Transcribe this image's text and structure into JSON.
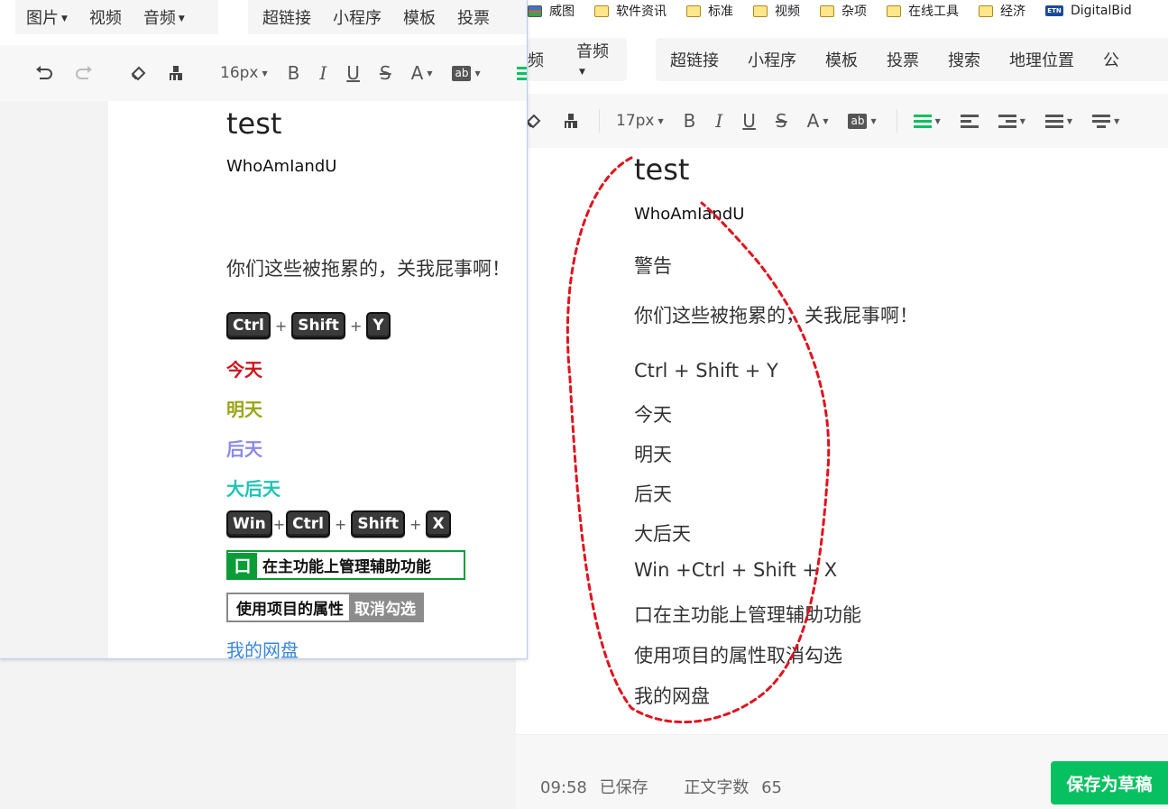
{
  "bookmarks": [
    {
      "icon": "image-icon",
      "label": "威图"
    },
    {
      "icon": "folder-icon",
      "label": "软件资讯"
    },
    {
      "icon": "folder-icon",
      "label": "标准"
    },
    {
      "icon": "folder-icon",
      "label": "视频"
    },
    {
      "icon": "folder-icon",
      "label": "杂项"
    },
    {
      "icon": "folder-icon",
      "label": "在线工具"
    },
    {
      "icon": "folder-icon",
      "label": "经济"
    },
    {
      "icon": "etn-icon",
      "label": "DigitalBid"
    }
  ],
  "left": {
    "menu_left": [
      "图片",
      "视频",
      "音频"
    ],
    "menu_right": [
      "超链接",
      "小程序",
      "模板",
      "投票"
    ],
    "toolbar": {
      "font_size": "16px",
      "ab_label": "ab"
    },
    "title": "test",
    "subtitle": "WhoAmIandU",
    "sentence": "你们这些被拖累的，关我屁事啊！",
    "shortcut1": [
      "Ctrl",
      "Shift",
      "Y"
    ],
    "plus": "+",
    "days": [
      {
        "text": "今天",
        "color": "#d0141c"
      },
      {
        "text": "明天",
        "color": "#9aa416"
      },
      {
        "text": "后天",
        "color": "#8a8be6"
      },
      {
        "text": "大后天",
        "color": "#1fc3b6"
      }
    ],
    "shortcut2": [
      "Win",
      "Ctrl",
      "Shift",
      "X"
    ],
    "green_box": {
      "checkbox": "口",
      "text": "在主功能上管理辅助功能",
      "color": "#0a9d37"
    },
    "gray_box": {
      "part1": "使用项目的属性",
      "part2": "取消勾选"
    },
    "link": "我的网盘"
  },
  "right": {
    "menu_left": [
      "频",
      "音频"
    ],
    "menu_right": [
      "超链接",
      "小程序",
      "模板",
      "投票",
      "搜索",
      "地理位置",
      "公"
    ],
    "toolbar": {
      "font_size": "17px",
      "ab_label": "ab",
      "accent": "#07c160"
    },
    "title": "test",
    "subtitle": "WhoAmIandU",
    "lines": [
      "警告",
      "你们这些被拖累的，关我屁事啊！",
      "Ctrl + Shift + Y",
      "今天",
      "明天",
      "后天",
      "大后天",
      "Win +Ctrl + Shift + X",
      "口在主功能上管理辅助功能",
      "使用项目的属性取消勾选",
      "我的网盘"
    ],
    "footer": {
      "time": "09:58",
      "saved": "已保存",
      "wordcount_label": "正文字数",
      "wordcount": "65",
      "save_draft": "保存为草稿"
    }
  },
  "annotation_color": "#e0121c"
}
